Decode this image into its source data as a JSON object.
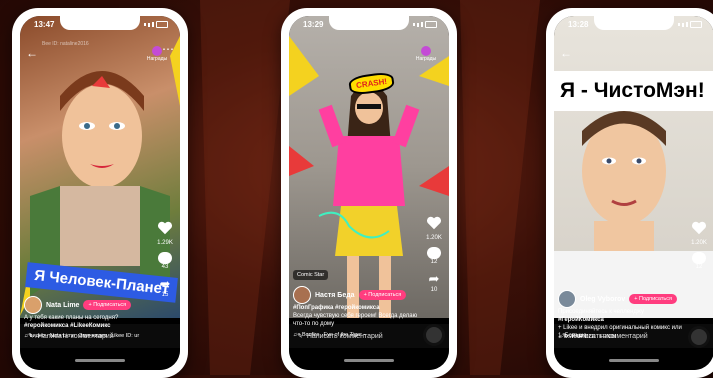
{
  "phones": [
    {
      "time": "13:47",
      "user_id": "Bee ID: nataline2016",
      "reward_label": "Награды",
      "banner": "Я Человек-Планет",
      "likes": "1.29K",
      "comments": "43",
      "shares": "15",
      "author": "Nata Lime",
      "follow": "+ Подписаться",
      "caption": "А у тебя какие планы на сегодня?",
      "tags": "#геройкомикса #LikeeКомикс",
      "music_1": "♫ видео - Nata Lime",
      "music_2": "Звук видео",
      "music_3": "Likee ID: ur",
      "comment_placeholder": "Написать комментарий"
    },
    {
      "time": "13:29",
      "reward_label": "Награды",
      "crash_text": "CRASH!",
      "sticker": "Comic Star",
      "likes": "1.20K",
      "comments": "12",
      "shares": "10",
      "author": "Настя Беда",
      "follow": "+ Подписаться",
      "tags": "#ПопГрафика #геройкомикса",
      "caption": "Всегда чувствую себя героем! Всегда делаю что-то по дому",
      "music_1": "♫ - Bonfire",
      "music_2": "Eye of the Tiger -",
      "comment_placeholder": "Написать комментарий"
    },
    {
      "time": "13:28",
      "title": "Я - ЧистоМэн!",
      "likes": "1.20K",
      "comments": "12",
      "author": "Oleg Vyborov",
      "follow": "+ Подписаться",
      "caption": "Присоединяйтесь к челленджу",
      "tags": "#ГеройКомикса",
      "caption_2": "+ Likee и внедрил оригинальный комикс или 1. Больше",
      "music_1": "♫ OSKAR DZE",
      "music_2": "FENDI",
      "comment_placeholder": "Написать комментарий"
    }
  ]
}
